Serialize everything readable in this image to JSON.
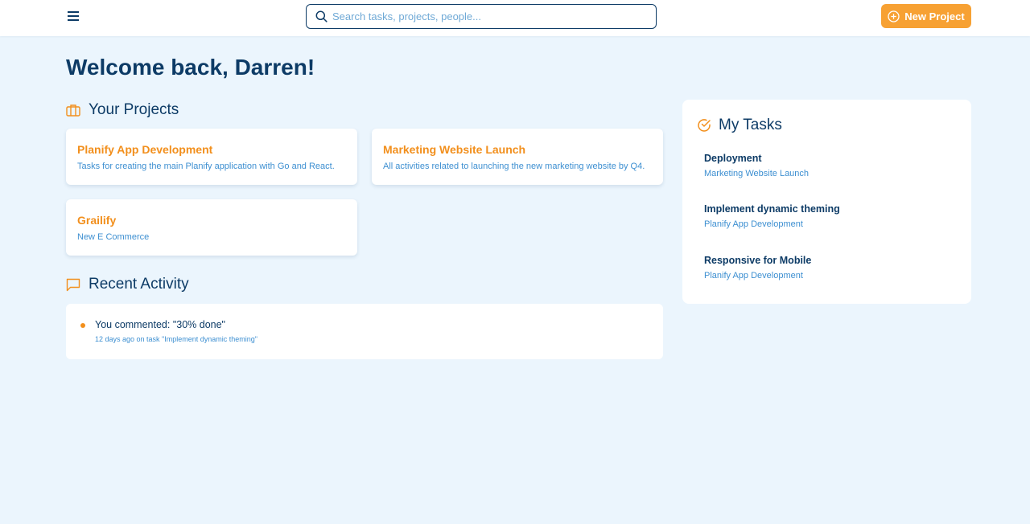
{
  "header": {
    "search_placeholder": "Search tasks, projects, people...",
    "new_project_label": "New Project"
  },
  "welcome": "Welcome back, Darren!",
  "projects_section": {
    "title": "Your Projects",
    "items": [
      {
        "title": "Planify App Development",
        "description": "Tasks for creating the main Planify application with Go and React."
      },
      {
        "title": "Marketing Website Launch",
        "description": "All activities related to launching the new marketing website by Q4."
      },
      {
        "title": "Grailify",
        "description": "New E Commerce"
      }
    ]
  },
  "activity_section": {
    "title": "Recent Activity",
    "items": [
      {
        "text": "You commented: \"30% done\"",
        "meta": "12 days ago on task \"Implement dynamic theming\""
      }
    ]
  },
  "tasks_section": {
    "title": "My Tasks",
    "items": [
      {
        "name": "Deployment",
        "project": "Marketing Website Launch"
      },
      {
        "name": "Implement dynamic theming",
        "project": "Planify App Development"
      },
      {
        "name": "Responsive for Mobile",
        "project": "Planify App Development"
      }
    ]
  },
  "colors": {
    "accent": "#f7a133",
    "primary": "#0d3b66",
    "link": "#3d8fd1",
    "background": "#ebf5fd"
  },
  "icons": {
    "menu": "hamburger-menu-icon",
    "search": "search-icon",
    "new_project": "plus-circle-icon",
    "projects": "briefcase-icon",
    "activity": "message-square-icon",
    "tasks": "check-circle-icon"
  }
}
